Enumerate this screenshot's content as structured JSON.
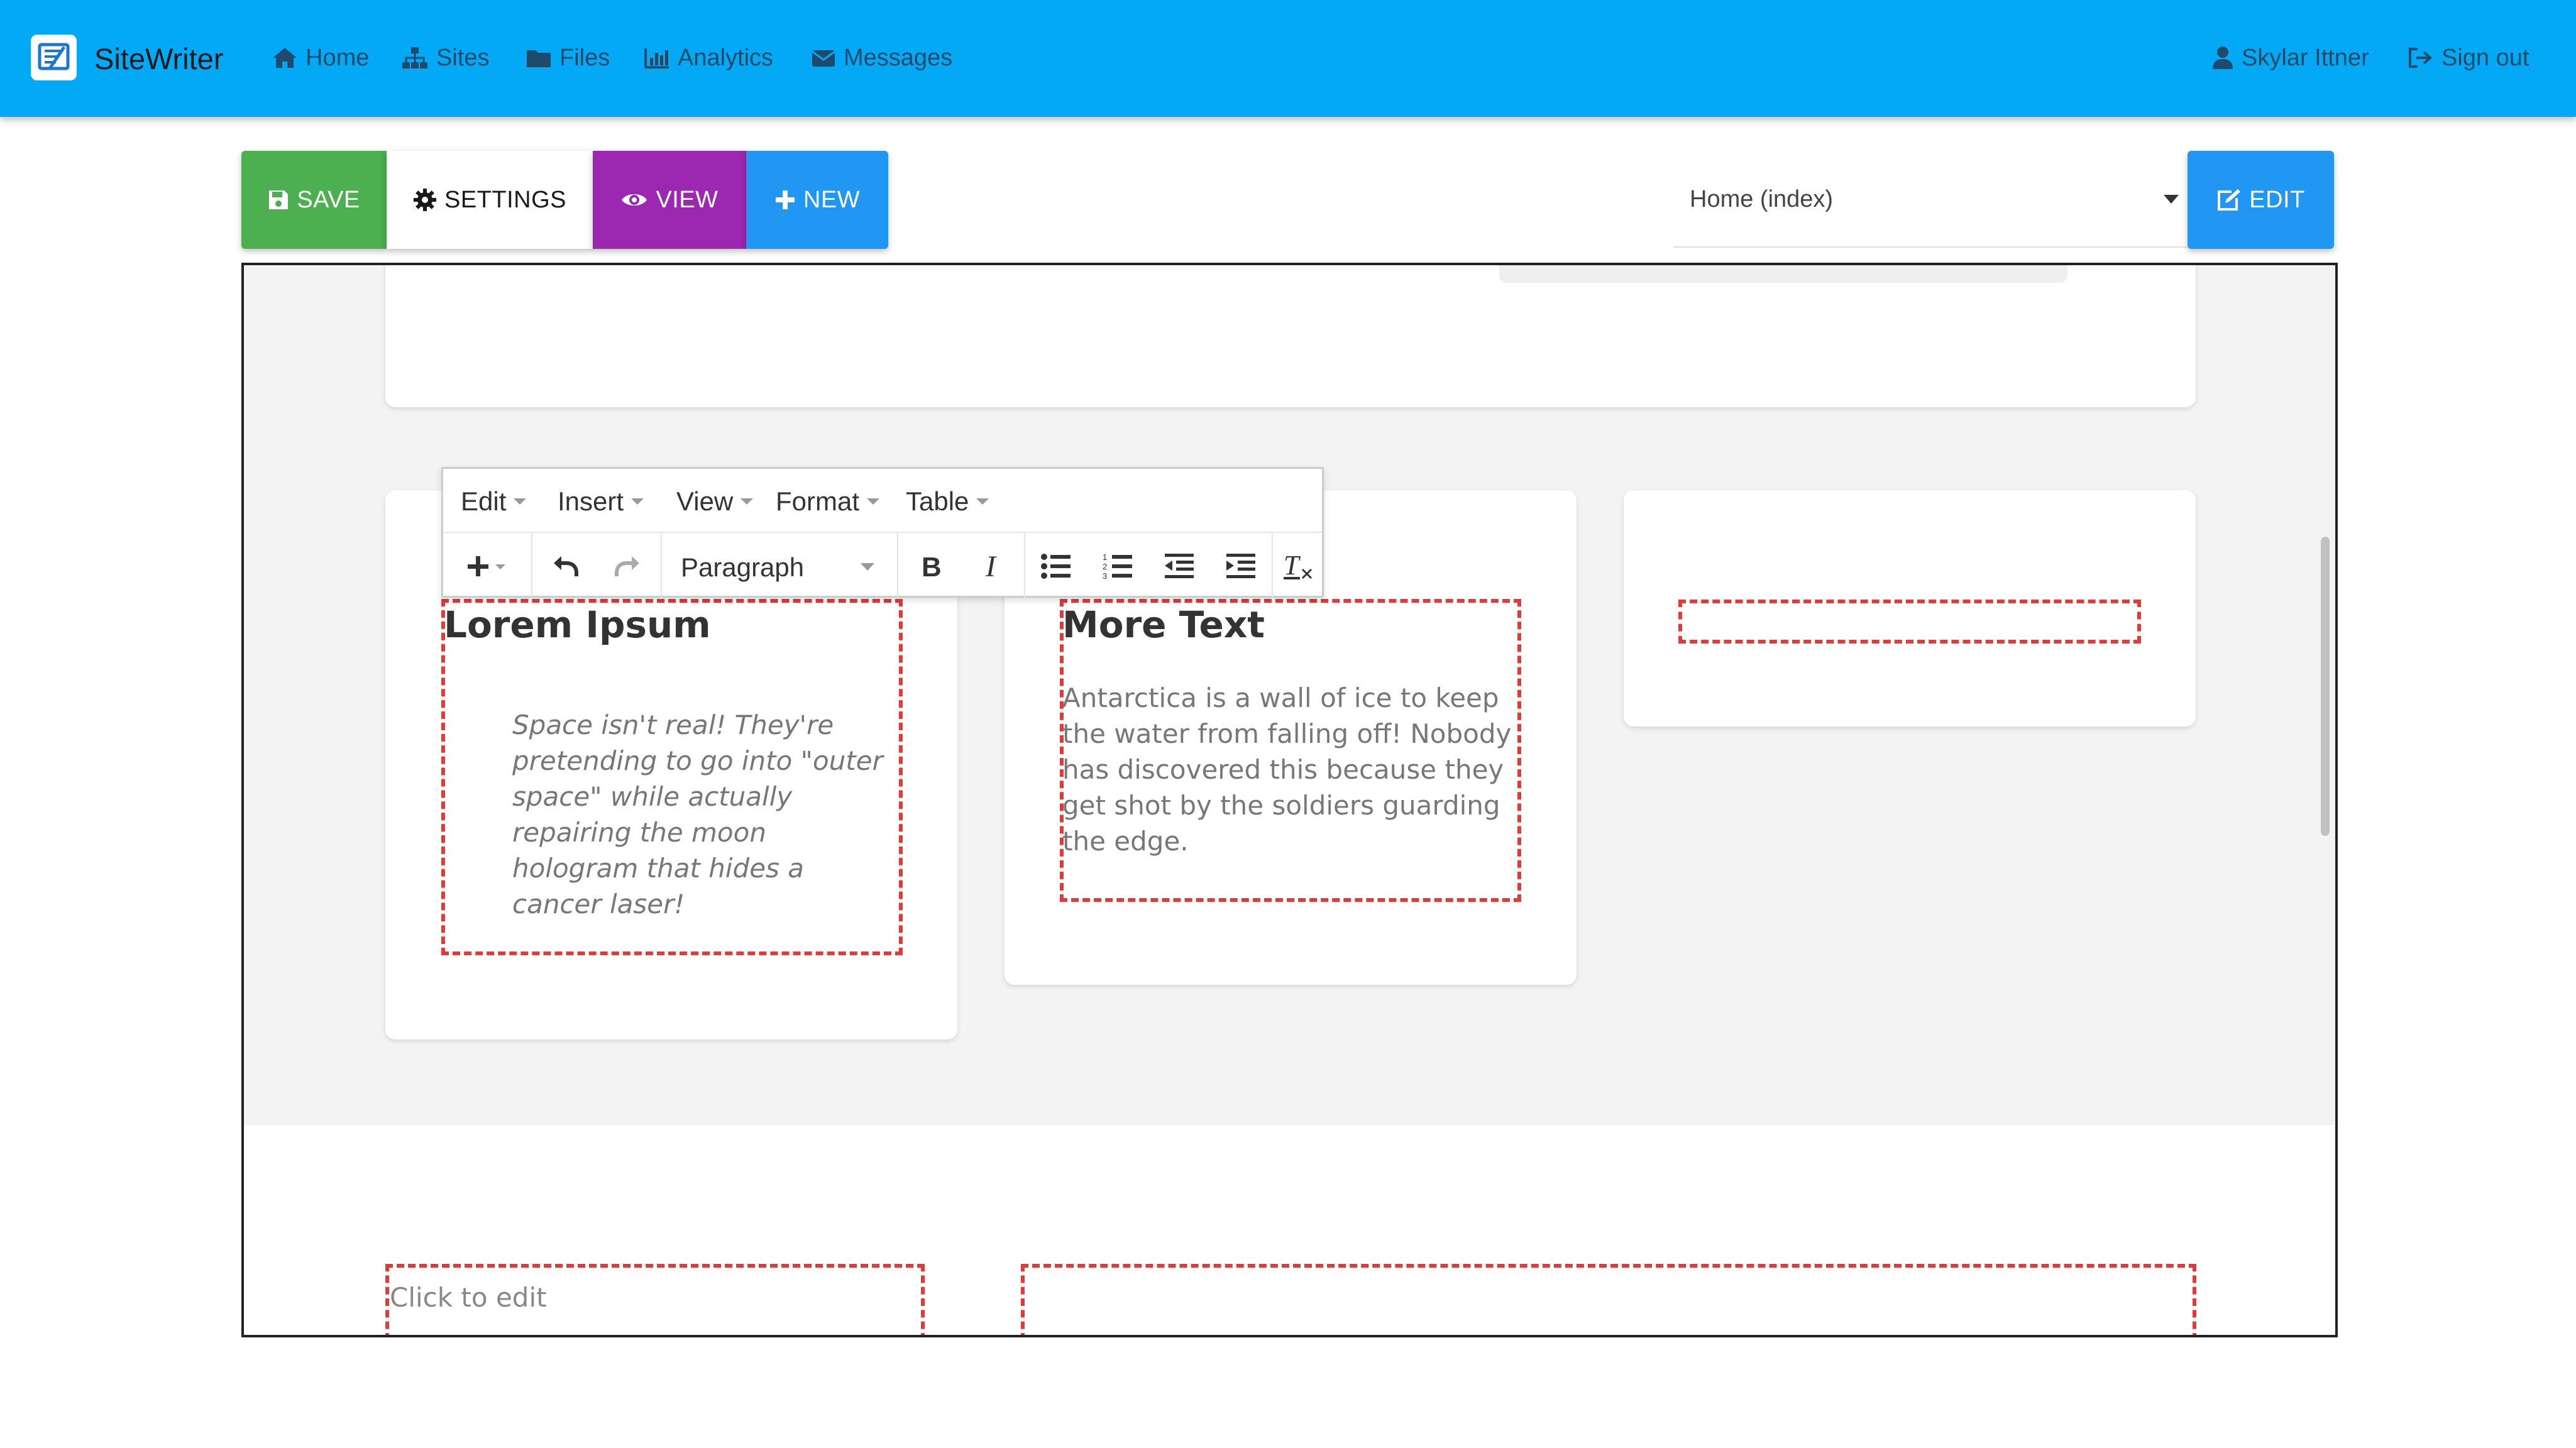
{
  "app": {
    "name": "SiteWriter"
  },
  "nav": {
    "items": [
      {
        "label": "Home",
        "icon": "home-icon"
      },
      {
        "label": "Sites",
        "icon": "sitemap-icon"
      },
      {
        "label": "Files",
        "icon": "folder-icon"
      },
      {
        "label": "Analytics",
        "icon": "bar-chart-icon"
      },
      {
        "label": "Messages",
        "icon": "envelope-icon"
      }
    ],
    "user": {
      "label": "Skylar Ittner",
      "icon": "user-icon"
    },
    "signout": {
      "label": "Sign out",
      "icon": "sign-out-icon"
    }
  },
  "toolbar": {
    "save_label": "SAVE",
    "settings_label": "SETTINGS",
    "view_label": "VIEW",
    "new_label": "NEW",
    "edit_label": "EDIT",
    "page_select": {
      "value": "Home (index)"
    }
  },
  "editor_menu": {
    "items": [
      "Edit",
      "Insert",
      "View",
      "Format",
      "Table"
    ],
    "format_select": "Paragraph"
  },
  "content": {
    "card1": {
      "title": "Lorem Ipsum",
      "quote": "Space isn't real!  They're pretending to go into \"outer space\" while actually repairing the moon hologram that hides a cancer laser!"
    },
    "card2": {
      "title": "More Text",
      "body": "Antarctica is a wall of ice to keep the water from falling off!  Nobody has discovered this because they get shot by the soldiers guarding the edge."
    },
    "footer": {
      "placeholder": "Click to edit"
    }
  },
  "colors": {
    "topbar": "#03a9f4",
    "save": "#4caf50",
    "view": "#9c27b0",
    "new": "#2196f3",
    "edit": "#2196f3",
    "editable_outline": "#e53935"
  }
}
